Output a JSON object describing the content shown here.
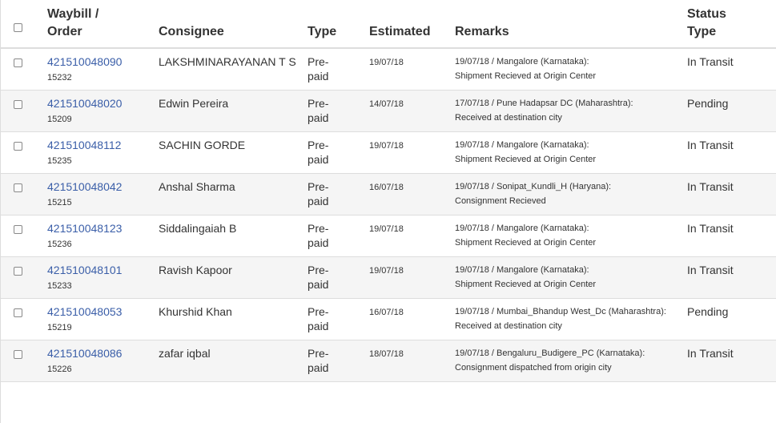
{
  "columns": {
    "waybill_line1": "Waybill /",
    "waybill_line2": "Order",
    "consignee": "Consignee",
    "type": "Type",
    "estimated": "Estimated",
    "remarks": "Remarks",
    "status_line1": "Status",
    "status_line2": "Type"
  },
  "rows": [
    {
      "waybill": "421510048090",
      "order": "15232",
      "consignee": "LAKSHMINARAYANAN T S",
      "type": "Pre-paid",
      "estimated": "19/07/18",
      "remark_location": "19/07/18 / Mangalore (Karnataka):",
      "remark_status": "Shipment Recieved at Origin Center",
      "status": "In Transit"
    },
    {
      "waybill": "421510048020",
      "order": "15209",
      "consignee": "Edwin Pereira",
      "type": "Pre-paid",
      "estimated": "14/07/18",
      "remark_location": "17/07/18 / Pune Hadapsar DC (Maharashtra):",
      "remark_status": "Received at destination city",
      "status": "Pending"
    },
    {
      "waybill": "421510048112",
      "order": "15235",
      "consignee": "SACHIN GORDE",
      "type": "Pre-paid",
      "estimated": "19/07/18",
      "remark_location": "19/07/18 / Mangalore (Karnataka):",
      "remark_status": "Shipment Recieved at Origin Center",
      "status": "In Transit"
    },
    {
      "waybill": "421510048042",
      "order": "15215",
      "consignee": "Anshal Sharma",
      "type": "Pre-paid",
      "estimated": "16/07/18",
      "remark_location": "19/07/18 / Sonipat_Kundli_H (Haryana):",
      "remark_status": "Consignment Recieved",
      "status": "In Transit"
    },
    {
      "waybill": "421510048123",
      "order": "15236",
      "consignee": "Siddalingaiah B",
      "type": "Pre-paid",
      "estimated": "19/07/18",
      "remark_location": "19/07/18 / Mangalore (Karnataka):",
      "remark_status": "Shipment Recieved at Origin Center",
      "status": "In Transit"
    },
    {
      "waybill": "421510048101",
      "order": "15233",
      "consignee": "Ravish Kapoor",
      "type": "Pre-paid",
      "estimated": "19/07/18",
      "remark_location": "19/07/18 / Mangalore (Karnataka):",
      "remark_status": "Shipment Recieved at Origin Center",
      "status": "In Transit"
    },
    {
      "waybill": "421510048053",
      "order": "15219",
      "consignee": "Khurshid Khan",
      "type": "Pre-paid",
      "estimated": "16/07/18",
      "remark_location": "19/07/18 / Mumbai_Bhandup West_Dc (Maharashtra):",
      "remark_status": "Received at destination city",
      "status": "Pending"
    },
    {
      "waybill": "421510048086",
      "order": "15226",
      "consignee": "zafar iqbal",
      "type": "Pre-paid",
      "estimated": "18/07/18",
      "remark_location": "19/07/18 / Bengaluru_Budigere_PC (Karnataka):",
      "remark_status": "Consignment dispatched from origin city",
      "status": "In Transit"
    }
  ]
}
